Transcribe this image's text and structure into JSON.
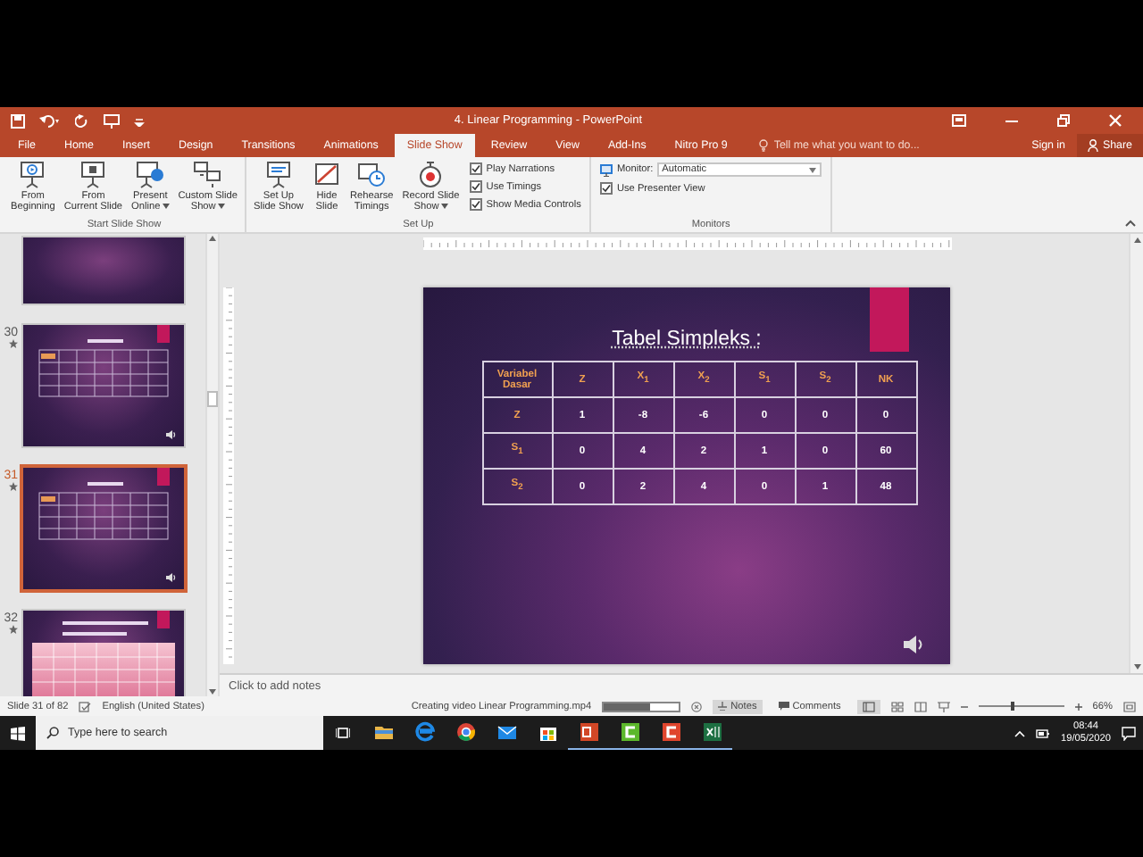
{
  "window": {
    "title": "4. Linear Programming - PowerPoint"
  },
  "menu_tabs": [
    {
      "label": "File",
      "selected": false
    },
    {
      "label": "Home",
      "selected": false
    },
    {
      "label": "Insert",
      "selected": false
    },
    {
      "label": "Design",
      "selected": false
    },
    {
      "label": "Transitions",
      "selected": false
    },
    {
      "label": "Animations",
      "selected": false
    },
    {
      "label": "Slide Show",
      "selected": true
    },
    {
      "label": "Review",
      "selected": false
    },
    {
      "label": "View",
      "selected": false
    },
    {
      "label": "Add-Ins",
      "selected": false
    },
    {
      "label": "Nitro Pro 9",
      "selected": false
    }
  ],
  "tell_me": {
    "placeholder": "Tell me what you want to do..."
  },
  "account": {
    "sign_in": "Sign in",
    "share": "Share"
  },
  "ribbon_groups": [
    {
      "label": "Start Slide Show",
      "items": [
        {
          "kind": "button",
          "lines": [
            "From",
            "Beginning"
          ],
          "dropdown": false
        },
        {
          "kind": "button",
          "lines": [
            "From",
            "Current Slide"
          ],
          "dropdown": false
        },
        {
          "kind": "button",
          "lines": [
            "Present",
            "Online"
          ],
          "dropdown": true
        },
        {
          "kind": "button",
          "lines": [
            "Custom Slide",
            "Show"
          ],
          "dropdown": true
        }
      ]
    },
    {
      "label": "Set Up",
      "items": [
        {
          "kind": "button",
          "lines": [
            "Set Up",
            "Slide Show"
          ],
          "dropdown": false
        },
        {
          "kind": "button",
          "lines": [
            "Hide",
            "Slide"
          ],
          "dropdown": false
        },
        {
          "kind": "button",
          "lines": [
            "Rehearse",
            "Timings"
          ],
          "dropdown": false
        },
        {
          "kind": "button",
          "lines": [
            "Record Slide",
            "Show"
          ],
          "dropdown": true
        },
        {
          "kind": "column",
          "items": [
            {
              "kind": "checkbox",
              "label": "Play Narrations",
              "checked": true
            },
            {
              "kind": "checkbox",
              "label": "Use Timings",
              "checked": true
            },
            {
              "kind": "checkbox",
              "label": "Show Media Controls",
              "checked": true
            }
          ]
        }
      ]
    },
    {
      "label": "Monitors",
      "items": [
        {
          "kind": "column",
          "items": [
            {
              "kind": "dropdown",
              "label": "Monitor:",
              "value": "Automatic"
            },
            {
              "kind": "checkbox",
              "label": "Use Presenter View",
              "checked": true
            }
          ]
        }
      ]
    }
  ],
  "thumbnails": [
    {
      "kind": "blank",
      "animated": false,
      "audio": false,
      "selected": false
    },
    {
      "kind": "table",
      "number": "30",
      "animated": true,
      "audio": true,
      "selected": false
    },
    {
      "kind": "table",
      "number": "31",
      "animated": true,
      "audio": true,
      "selected": true
    },
    {
      "kind": "list",
      "number": "32",
      "animated": true,
      "audio": false,
      "selected": false
    }
  ],
  "slide": {
    "title": "Tabel Simpleks :",
    "audio": true,
    "table": {
      "columns": [
        "Variabel Dasar",
        "Z",
        "X$_{1}$",
        "X$_{2}$",
        "S$_{1}$",
        "S$_{2}$",
        "NK"
      ],
      "rows": [
        [
          "Z",
          "1",
          "-8",
          "-6",
          "0",
          "0",
          "0"
        ],
        [
          "S$_{1}$",
          "0",
          "4",
          "2",
          "1",
          "0",
          "60"
        ],
        [
          "S$_{2}$",
          "0",
          "2",
          "4",
          "0",
          "1",
          "48"
        ]
      ]
    }
  },
  "notes": {
    "placeholder": "Click to add notes"
  },
  "status_bar": {
    "slide_info": "Slide 31 of 82",
    "language": "English (United States)",
    "progress_text": "Creating video Linear Programming.mp4",
    "progress": {
      "level": 0.62
    },
    "notes_button": "Notes",
    "comments_button": "Comments",
    "zoom_slider": {
      "level": 0.4
    },
    "zoom": "66%"
  },
  "taskbar": {
    "search": {
      "placeholder": "Type here to search"
    },
    "apps": [
      {
        "open": false
      },
      {
        "open": false
      },
      {
        "open": false
      },
      {
        "open": false
      },
      {
        "open": false
      },
      {
        "open": true
      },
      {
        "open": true
      },
      {
        "open": true
      },
      {
        "open": true
      }
    ],
    "time": "08:44",
    "date": "19/05/2020"
  }
}
